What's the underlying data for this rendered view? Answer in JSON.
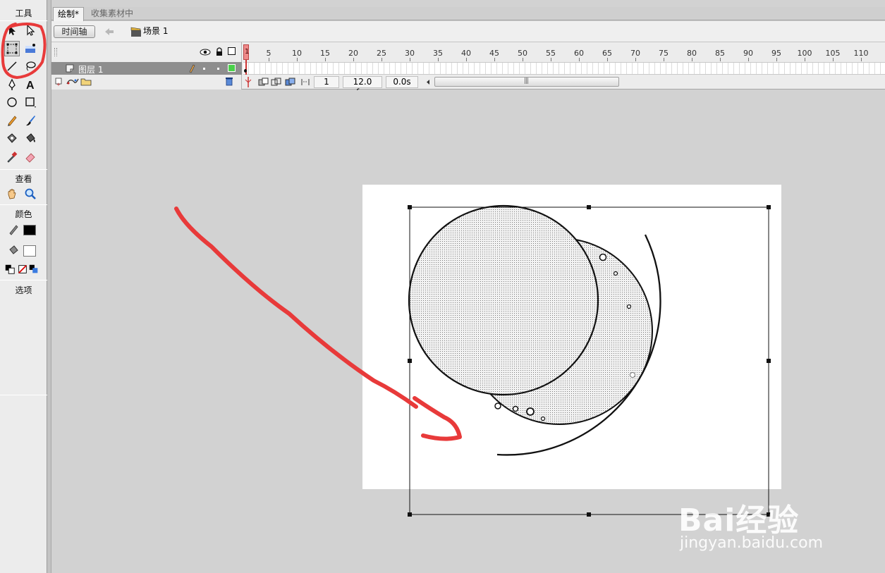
{
  "toolbox": {
    "title": "工具",
    "view_title": "查看",
    "color_title": "颜色",
    "options_title": "选项"
  },
  "document_tabs": [
    {
      "label": "绘制*"
    },
    {
      "label": "收集素材中"
    }
  ],
  "edit_bar": {
    "timeline_button": "时间轴",
    "scene_label": "场景 1"
  },
  "timeline": {
    "ruler_numbers": [
      "1",
      "5",
      "10",
      "15",
      "20",
      "25",
      "30",
      "35",
      "40",
      "45",
      "50",
      "55",
      "60",
      "65",
      "70",
      "75",
      "80",
      "85",
      "90",
      "95",
      "100",
      "105",
      "110"
    ],
    "layer_name": "图层 1",
    "layer_color": "#4ad04a",
    "current_frame": "1",
    "frame_rate": "12.0 fps",
    "elapsed_time": "0.0s"
  },
  "colors": {
    "stage_bg": "#ffffff",
    "workspace_bg": "#d2d2d2",
    "annotation_red": "#e83a3a"
  },
  "watermark": {
    "logo": "Bai经验",
    "url": "jingyan.baidu.com"
  }
}
